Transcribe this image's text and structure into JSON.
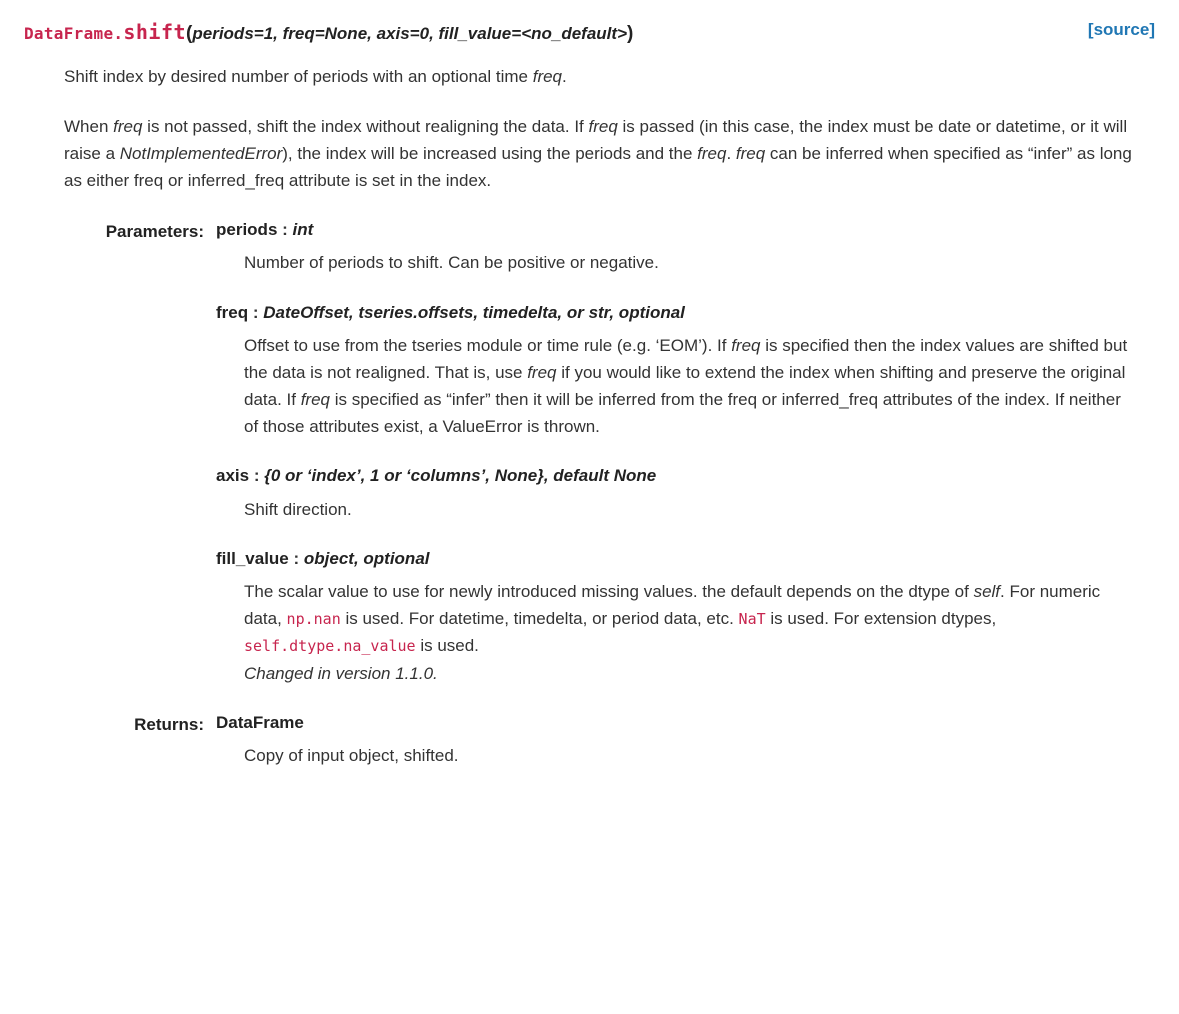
{
  "signature": {
    "class_name": "DataFrame.",
    "func_name": "shift",
    "params_raw": "periods=1, freq=None, axis=0, fill_value=<no_default>"
  },
  "source_link": "[source]",
  "summary_1a": "Shift index by desired number of periods with an optional time ",
  "summary_1b": "freq",
  "summary_1c": ".",
  "summary_2a": "When ",
  "summary_2b": "freq",
  "summary_2c": " is not passed, shift the index without realigning the data. If ",
  "summary_2d": "freq",
  "summary_2e": " is passed (in this case, the index must be date or datetime, or it will raise a ",
  "summary_2f": "NotImplementedError",
  "summary_2g": "), the index will be increased using the periods and the ",
  "summary_2h": "freq",
  "summary_2i": ". ",
  "summary_2j": "freq",
  "summary_2k": " can be inferred when specified as “infer” as long as either freq or inferred_freq attribute is set in the index.",
  "labels": {
    "parameters": "Parameters:",
    "returns": "Returns:"
  },
  "params": {
    "periods": {
      "name": "periods",
      "type": "int",
      "desc": "Number of periods to shift. Can be positive or negative."
    },
    "freq": {
      "name": "freq",
      "type": "DateOffset, tseries.offsets, timedelta, or str, optional",
      "d1": "Offset to use from the tseries module or time rule (e.g. ‘EOM’). If ",
      "d2": "freq",
      "d3": " is specified then the index values are shifted but the data is not realigned. That is, use ",
      "d4": "freq",
      "d5": " if you would like to extend the index when shifting and preserve the original data. If ",
      "d6": "freq",
      "d7": " is specified as “infer” then it will be inferred from the freq or inferred_freq attributes of the index. If neither of those attributes exist, a ValueError is thrown."
    },
    "axis": {
      "name": "axis",
      "type": "{0 or ‘index’, 1 or ‘columns’, None}, default None",
      "desc": "Shift direction."
    },
    "fill_value": {
      "name": "fill_value",
      "type": "object, optional",
      "d1": "The scalar value to use for newly introduced missing values. the default depends on the dtype of ",
      "d2": "self",
      "d3": ". For numeric data, ",
      "d4": "np.nan",
      "d5": " is used. For datetime, timedelta, or period data, etc. ",
      "d6": "NaT",
      "d7": " is used. For extension dtypes, ",
      "d8": "self.dtype.na_value",
      "d9": " is used.",
      "changed": "Changed in version 1.1.0."
    }
  },
  "returns": {
    "type": "DataFrame",
    "desc": "Copy of input object, shifted."
  }
}
